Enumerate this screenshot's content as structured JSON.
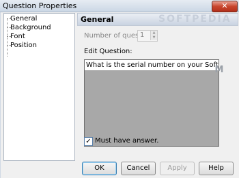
{
  "window": {
    "title": "Question Properties",
    "close_glyph": "✕"
  },
  "watermark": "SOFTPEDIA",
  "tree": {
    "items": [
      "General",
      "Background",
      "Font",
      "Position"
    ]
  },
  "section": {
    "title": "General"
  },
  "form": {
    "num_questions_label": "Number of questions:",
    "num_questions_value": "1",
    "edit_question_label": "Edit Question:",
    "question_text": "What is the serial number on your Softpedia ...",
    "m_icon": "M",
    "must_answer_label": "Must have answer.",
    "must_answer_checked": "✓"
  },
  "buttons": {
    "ok": "OK",
    "cancel": "Cancel",
    "apply": "Apply",
    "help": "Help"
  }
}
